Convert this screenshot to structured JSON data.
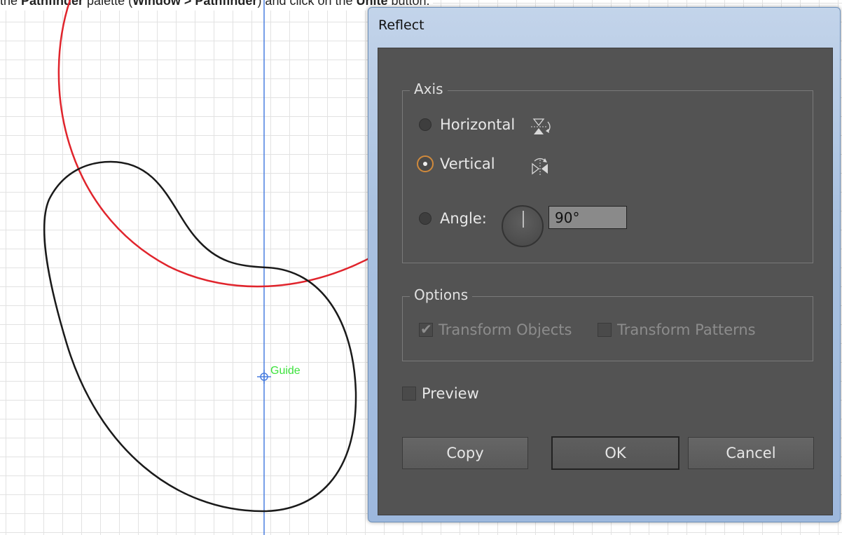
{
  "instruction": {
    "parts": [
      {
        "text": "the ",
        "bold": false
      },
      {
        "text": "Pathfinder",
        "bold": true
      },
      {
        "text": " palette (",
        "bold": false
      },
      {
        "text": "Window > Pathfinder",
        "bold": true
      },
      {
        "text": ") and click on the ",
        "bold": false
      },
      {
        "text": "Unite",
        "bold": true
      },
      {
        "text": " button.",
        "bold": false
      }
    ]
  },
  "canvas": {
    "guide_label": "Guide",
    "colors": {
      "red_path": "#e0242c",
      "black_path": "#1a1a1a",
      "guide_line": "#4a7ee0",
      "guide_label": "#3de23d"
    }
  },
  "dialog": {
    "title": "Reflect",
    "axis": {
      "legend": "Axis",
      "horizontal_label": "Horizontal",
      "vertical_label": "Vertical",
      "angle_label": "Angle:",
      "angle_value": "90°",
      "selected": "vertical"
    },
    "options": {
      "legend": "Options",
      "transform_objects_label": "Transform Objects",
      "transform_objects_checked": true,
      "transform_patterns_label": "Transform Patterns",
      "transform_patterns_checked": false
    },
    "preview_label": "Preview",
    "preview_checked": false,
    "buttons": {
      "copy": "Copy",
      "ok": "OK",
      "cancel": "Cancel"
    }
  }
}
